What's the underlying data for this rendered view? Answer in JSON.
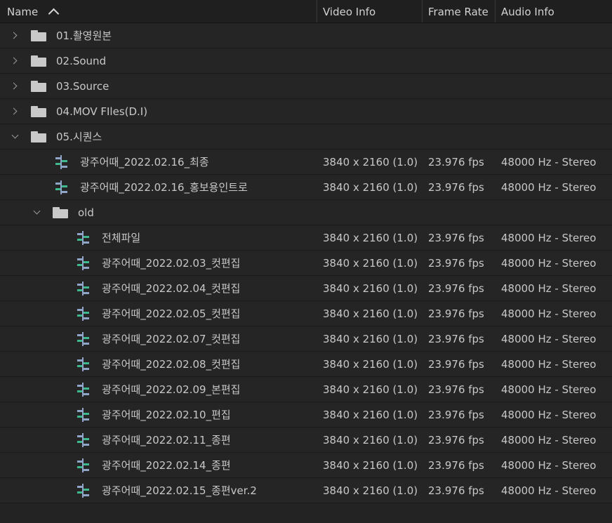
{
  "columns": {
    "name": "Name",
    "video_info": "Video Info",
    "frame_rate": "Frame Rate",
    "audio_info": "Audio Info"
  },
  "rows": [
    {
      "type": "folder",
      "depth": 0,
      "expanded": false,
      "name": "01.촬영원본"
    },
    {
      "type": "folder",
      "depth": 0,
      "expanded": false,
      "name": "02.Sound"
    },
    {
      "type": "folder",
      "depth": 0,
      "expanded": false,
      "name": "03.Source"
    },
    {
      "type": "folder",
      "depth": 0,
      "expanded": false,
      "name": "04.MOV FIles(D.I)"
    },
    {
      "type": "folder",
      "depth": 0,
      "expanded": true,
      "name": "05.시퀀스"
    },
    {
      "type": "sequence",
      "depth": 1,
      "name": "광주어때_2022.02.16_최종",
      "video": "3840 x 2160 (1.0)",
      "fps": "23.976 fps",
      "audio": "48000 Hz - Stereo"
    },
    {
      "type": "sequence",
      "depth": 1,
      "name": "광주어때_2022.02.16_홍보용인트로",
      "video": "3840 x 2160 (1.0)",
      "fps": "23.976 fps",
      "audio": "48000 Hz - Stereo"
    },
    {
      "type": "folder",
      "depth": 1,
      "expanded": true,
      "name": "old"
    },
    {
      "type": "sequence",
      "depth": 2,
      "name": "전체파일",
      "video": "3840 x 2160 (1.0)",
      "fps": "23.976 fps",
      "audio": "48000 Hz - Stereo"
    },
    {
      "type": "sequence",
      "depth": 2,
      "name": "광주어때_2022.02.03_컷편집",
      "video": "3840 x 2160 (1.0)",
      "fps": "23.976 fps",
      "audio": "48000 Hz - Stereo"
    },
    {
      "type": "sequence",
      "depth": 2,
      "name": "광주어때_2022.02.04_컷편집",
      "video": "3840 x 2160 (1.0)",
      "fps": "23.976 fps",
      "audio": "48000 Hz - Stereo"
    },
    {
      "type": "sequence",
      "depth": 2,
      "name": "광주어때_2022.02.05_컷편집",
      "video": "3840 x 2160 (1.0)",
      "fps": "23.976 fps",
      "audio": "48000 Hz - Stereo"
    },
    {
      "type": "sequence",
      "depth": 2,
      "name": "광주어때_2022.02.07_컷편집",
      "video": "3840 x 2160 (1.0)",
      "fps": "23.976 fps",
      "audio": "48000 Hz - Stereo"
    },
    {
      "type": "sequence",
      "depth": 2,
      "name": "광주어때_2022.02.08_컷편집",
      "video": "3840 x 2160 (1.0)",
      "fps": "23.976 fps",
      "audio": "48000 Hz - Stereo"
    },
    {
      "type": "sequence",
      "depth": 2,
      "name": "광주어때_2022.02.09_본편집",
      "video": "3840 x 2160 (1.0)",
      "fps": "23.976 fps",
      "audio": "48000 Hz - Stereo"
    },
    {
      "type": "sequence",
      "depth": 2,
      "name": "광주어때_2022.02.10_편집",
      "video": "3840 x 2160 (1.0)",
      "fps": "23.976 fps",
      "audio": "48000 Hz - Stereo"
    },
    {
      "type": "sequence",
      "depth": 2,
      "name": "광주어때_2022.02.11_종편",
      "video": "3840 x 2160 (1.0)",
      "fps": "23.976 fps",
      "audio": "48000 Hz - Stereo"
    },
    {
      "type": "sequence",
      "depth": 2,
      "name": "광주어때_2022.02.14_종편",
      "video": "3840 x 2160 (1.0)",
      "fps": "23.976 fps",
      "audio": "48000 Hz - Stereo"
    },
    {
      "type": "sequence",
      "depth": 2,
      "name": "광주어때_2022.02.15_종편ver.2",
      "video": "3840 x 2160 (1.0)",
      "fps": "23.976 fps",
      "audio": "48000 Hz - Stereo"
    }
  ],
  "icons": {
    "sort": "sort-ascending-icon",
    "folder": "folder-icon",
    "sequence": "sequence-icon",
    "collapsed": "chevron-right-icon",
    "expanded": "chevron-down-icon"
  },
  "colors": {
    "background": "#252525",
    "header": "#1f1f1f",
    "folder": "#c9c9c9",
    "sequence_green": "#3fb98f",
    "sequence_blue": "#8fa6c8"
  }
}
